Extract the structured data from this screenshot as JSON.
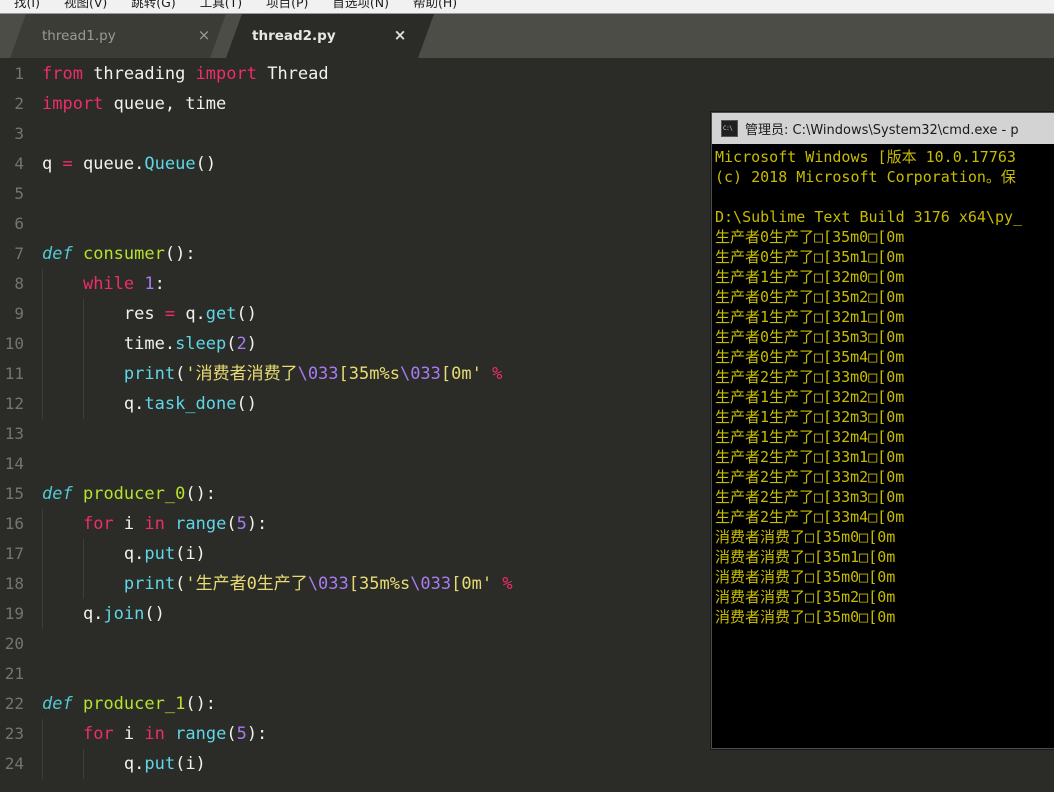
{
  "menubar": {
    "items": [
      "找(I)",
      "视图(V)",
      "跳转(G)",
      "工具(T)",
      "项目(P)",
      "首选项(N)",
      "帮助(H)"
    ]
  },
  "editor": {
    "tabs": [
      {
        "label": "thread1.py",
        "close": "×",
        "active": false
      },
      {
        "label": "thread2.py",
        "close": "×",
        "active": true
      }
    ],
    "line_numbers": [
      "1",
      "2",
      "3",
      "4",
      "5",
      "6",
      "7",
      "8",
      "9",
      "10",
      "11",
      "12",
      "13",
      "14",
      "15",
      "16",
      "17",
      "18",
      "19",
      "20",
      "21",
      "22",
      "23",
      "24"
    ],
    "code_lines": [
      {
        "n": 1,
        "tokens": [
          {
            "t": "from",
            "c": "k"
          },
          {
            "t": " threading ",
            "c": "pl"
          },
          {
            "t": "import",
            "c": "k"
          },
          {
            "t": " Thread",
            "c": "pl"
          }
        ]
      },
      {
        "n": 2,
        "tokens": [
          {
            "t": "import",
            "c": "k"
          },
          {
            "t": " queue, time",
            "c": "pl"
          }
        ]
      },
      {
        "n": 3,
        "tokens": []
      },
      {
        "n": 4,
        "tokens": [
          {
            "t": "q ",
            "c": "pl"
          },
          {
            "t": "=",
            "c": "op"
          },
          {
            "t": " queue.",
            "c": "pl"
          },
          {
            "t": "Queue",
            "c": "cls"
          },
          {
            "t": "()",
            "c": "pl"
          }
        ]
      },
      {
        "n": 5,
        "tokens": []
      },
      {
        "n": 6,
        "tokens": []
      },
      {
        "n": 7,
        "tokens": [
          {
            "t": "def",
            "c": "kd"
          },
          {
            "t": " ",
            "c": "pl"
          },
          {
            "t": "consumer",
            "c": "fn"
          },
          {
            "t": "():",
            "c": "pl"
          }
        ]
      },
      {
        "n": 8,
        "tokens": [
          {
            "t": "    ",
            "c": "pl"
          },
          {
            "t": "while",
            "c": "k"
          },
          {
            "t": " ",
            "c": "pl"
          },
          {
            "t": "1",
            "c": "num"
          },
          {
            "t": ":",
            "c": "pl"
          }
        ]
      },
      {
        "n": 9,
        "tokens": [
          {
            "t": "        res ",
            "c": "pl"
          },
          {
            "t": "=",
            "c": "op"
          },
          {
            "t": " q.",
            "c": "pl"
          },
          {
            "t": "get",
            "c": "mth"
          },
          {
            "t": "()",
            "c": "pl"
          }
        ]
      },
      {
        "n": 10,
        "tokens": [
          {
            "t": "        time.",
            "c": "pl"
          },
          {
            "t": "sleep",
            "c": "mth"
          },
          {
            "t": "(",
            "c": "pl"
          },
          {
            "t": "2",
            "c": "num"
          },
          {
            "t": ")",
            "c": "pl"
          }
        ]
      },
      {
        "n": 11,
        "tokens": [
          {
            "t": "        ",
            "c": "pl"
          },
          {
            "t": "print",
            "c": "mth"
          },
          {
            "t": "(",
            "c": "pl"
          },
          {
            "t": "'消费者消费了",
            "c": "str"
          },
          {
            "t": "\\033",
            "c": "esc"
          },
          {
            "t": "[35m%s",
            "c": "str"
          },
          {
            "t": "\\033",
            "c": "esc"
          },
          {
            "t": "[0m'",
            "c": "str"
          },
          {
            "t": " ",
            "c": "pl"
          },
          {
            "t": "%",
            "c": "op"
          }
        ]
      },
      {
        "n": 12,
        "tokens": [
          {
            "t": "        q.",
            "c": "pl"
          },
          {
            "t": "task_done",
            "c": "mth"
          },
          {
            "t": "()",
            "c": "pl"
          }
        ]
      },
      {
        "n": 13,
        "tokens": []
      },
      {
        "n": 14,
        "tokens": []
      },
      {
        "n": 15,
        "tokens": [
          {
            "t": "def",
            "c": "kd"
          },
          {
            "t": " ",
            "c": "pl"
          },
          {
            "t": "producer_0",
            "c": "fn"
          },
          {
            "t": "():",
            "c": "pl"
          }
        ]
      },
      {
        "n": 16,
        "tokens": [
          {
            "t": "    ",
            "c": "pl"
          },
          {
            "t": "for",
            "c": "k"
          },
          {
            "t": " i ",
            "c": "pl"
          },
          {
            "t": "in",
            "c": "k"
          },
          {
            "t": " ",
            "c": "pl"
          },
          {
            "t": "range",
            "c": "mth"
          },
          {
            "t": "(",
            "c": "pl"
          },
          {
            "t": "5",
            "c": "num"
          },
          {
            "t": "):",
            "c": "pl"
          }
        ]
      },
      {
        "n": 17,
        "tokens": [
          {
            "t": "        q.",
            "c": "pl"
          },
          {
            "t": "put",
            "c": "mth"
          },
          {
            "t": "(i)",
            "c": "pl"
          }
        ]
      },
      {
        "n": 18,
        "tokens": [
          {
            "t": "        ",
            "c": "pl"
          },
          {
            "t": "print",
            "c": "mth"
          },
          {
            "t": "(",
            "c": "pl"
          },
          {
            "t": "'生产者0生产了",
            "c": "str"
          },
          {
            "t": "\\033",
            "c": "esc"
          },
          {
            "t": "[35m%s",
            "c": "str"
          },
          {
            "t": "\\033",
            "c": "esc"
          },
          {
            "t": "[0m'",
            "c": "str"
          },
          {
            "t": " ",
            "c": "pl"
          },
          {
            "t": "%",
            "c": "op"
          }
        ]
      },
      {
        "n": 19,
        "tokens": [
          {
            "t": "    q.",
            "c": "pl"
          },
          {
            "t": "join",
            "c": "mth"
          },
          {
            "t": "()",
            "c": "pl"
          }
        ]
      },
      {
        "n": 20,
        "tokens": []
      },
      {
        "n": 21,
        "tokens": []
      },
      {
        "n": 22,
        "tokens": [
          {
            "t": "def",
            "c": "kd"
          },
          {
            "t": " ",
            "c": "pl"
          },
          {
            "t": "producer_1",
            "c": "fn"
          },
          {
            "t": "():",
            "c": "pl"
          }
        ]
      },
      {
        "n": 23,
        "tokens": [
          {
            "t": "    ",
            "c": "pl"
          },
          {
            "t": "for",
            "c": "k"
          },
          {
            "t": " i ",
            "c": "pl"
          },
          {
            "t": "in",
            "c": "k"
          },
          {
            "t": " ",
            "c": "pl"
          },
          {
            "t": "range",
            "c": "mth"
          },
          {
            "t": "(",
            "c": "pl"
          },
          {
            "t": "5",
            "c": "num"
          },
          {
            "t": "):",
            "c": "pl"
          }
        ]
      },
      {
        "n": 24,
        "tokens": [
          {
            "t": "        q.",
            "c": "pl"
          },
          {
            "t": "put",
            "c": "mth"
          },
          {
            "t": "(i)",
            "c": "pl"
          }
        ]
      }
    ]
  },
  "console": {
    "title": "管理员: C:\\Windows\\System32\\cmd.exe - p",
    "icon": "cmd-icon",
    "lines": [
      "Microsoft Windows [版本 10.0.17763",
      "(c) 2018 Microsoft Corporation。保",
      "",
      "D:\\Sublime Text Build 3176 x64\\py_",
      "生产者0生产了□[35m0□[0m",
      "生产者0生产了□[35m1□[0m",
      "生产者1生产了□[32m0□[0m",
      "生产者0生产了□[35m2□[0m",
      "生产者1生产了□[32m1□[0m",
      "生产者0生产了□[35m3□[0m",
      "生产者0生产了□[35m4□[0m",
      "生产者2生产了□[33m0□[0m",
      "生产者1生产了□[32m2□[0m",
      "生产者1生产了□[32m3□[0m",
      "生产者1生产了□[32m4□[0m",
      "生产者2生产了□[33m1□[0m",
      "生产者2生产了□[33m2□[0m",
      "生产者2生产了□[33m3□[0m",
      "生产者2生产了□[33m4□[0m",
      "消费者消费了□[35m0□[0m",
      "消费者消费了□[35m1□[0m",
      "消费者消费了□[35m0□[0m",
      "消费者消费了□[35m2□[0m",
      "消费者消费了□[35m0□[0m"
    ]
  },
  "colors": {
    "editor_bg": "#2b2b27",
    "tabbar_bg": "#4d4d47",
    "console_bg": "#000000",
    "console_fg": "#c6bc00",
    "keyword": "#ef2d6b",
    "function": "#b7e22d",
    "string": "#e7db74",
    "number": "#a77bf3",
    "method": "#5fd7e8"
  }
}
